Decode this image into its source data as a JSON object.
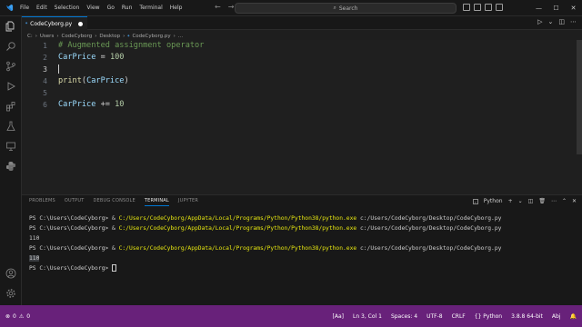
{
  "menu": [
    "File",
    "Edit",
    "Selection",
    "View",
    "Go",
    "Run",
    "Terminal",
    "Help"
  ],
  "search": {
    "placeholder": "Search"
  },
  "tab": {
    "filename": "CodeCyborg.py",
    "icon": "python-icon"
  },
  "breadcrumb": [
    "C:",
    "Users",
    "CodeCyborg",
    "Desktop",
    "CodeCyborg.py",
    "..."
  ],
  "editor": {
    "lines": [
      {
        "num": "1",
        "text": "# Augmented assignment operator"
      },
      {
        "num": "2",
        "var": "CarPrice",
        "op": " = ",
        "val": "100"
      },
      {
        "num": "3"
      },
      {
        "num": "4",
        "fn": "print",
        "arg": "CarPrice"
      },
      {
        "num": "5"
      },
      {
        "num": "6",
        "var": "CarPrice",
        "op": " += ",
        "val": "10"
      }
    ]
  },
  "panel": {
    "tabs": [
      "PROBLEMS",
      "OUTPUT",
      "DEBUG CONSOLE",
      "TERMINAL",
      "JUPYTER"
    ],
    "active_tab": "TERMINAL",
    "terminal_label": "Python"
  },
  "terminal": {
    "prompt": "PS C:\\Users\\CodeCyborg> & ",
    "exe": "C:/Users/CodeCyborg/AppData/Local/Programs/Python/Python38/python.exe",
    "script": " c:/Users/CodeCyborg/Desktop/CodeCyborg.py",
    "output1": "110",
    "output2": "110",
    "final_prompt": "PS C:\\Users\\CodeCyborg> "
  },
  "status": {
    "errors": "0",
    "warnings": "0",
    "items": [
      "[Aa]",
      "Ln 3, Col 1",
      "Spaces: 4",
      "UTF-8",
      "CRLF",
      "Python",
      "3.8.8 64-bit",
      "Abj"
    ]
  },
  "colors": {
    "statusbar": "#68217a",
    "accent": "#0078d4",
    "terminal_path": "#e5e510"
  }
}
